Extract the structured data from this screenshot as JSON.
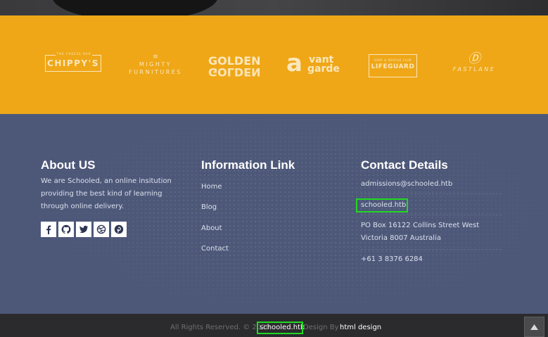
{
  "brands": {
    "chippys": {
      "tagline": "THE CHEESE BAR",
      "name": "CHIPPY'S"
    },
    "mighty": {
      "mark": "≡",
      "name": "MIGHTY FURNITURES"
    },
    "golden": {
      "name": "GOLDEN"
    },
    "vantgarde": {
      "initial": "a",
      "line1": "vant",
      "line2": "garde"
    },
    "lifeguard": {
      "tagline": "SURF & RESCUE CLUB",
      "name": "LIFEGUARD"
    },
    "fastlane": {
      "mark": "Ⓓ",
      "name": "FASTLANE"
    }
  },
  "about": {
    "title": "About US",
    "text": "We are Schooled, an online insitution providing the best kind of learning through online delivery.",
    "social": [
      "facebook-icon",
      "github-icon",
      "twitter-icon",
      "dribbble-icon",
      "pinterest-icon"
    ]
  },
  "info": {
    "title": "Information Link",
    "links": [
      "Home",
      "Blog",
      "About",
      "Contact"
    ]
  },
  "contact": {
    "title": "Contact Details",
    "email": "admissions@schooled.htb",
    "site": "schooled.htb",
    "address": "PO Box 16122 Collins Street West Victoria 8007 Australia",
    "phone": "+61 3 8376 6284"
  },
  "copyright": {
    "prefix": "All Rights Reserved. © 2020",
    "site": "schooled.htb",
    "design_by": "Design By :",
    "designer": "html design"
  },
  "colors": {
    "brand_band": "#efa717",
    "footer": "#4d5879",
    "bottom_bar": "#2b2b2e",
    "highlight": "#22d822"
  }
}
